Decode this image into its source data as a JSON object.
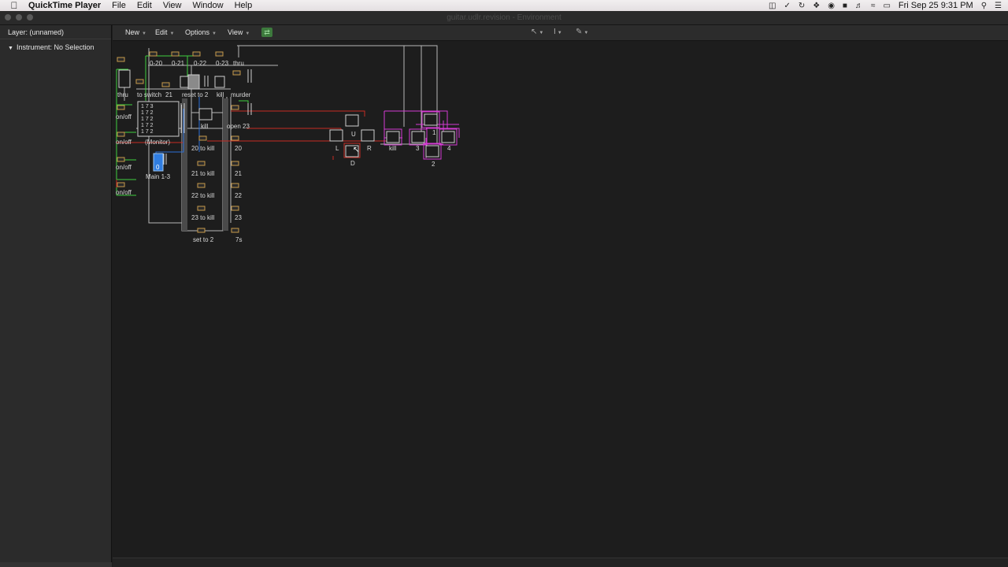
{
  "menubar": {
    "app_name": "QuickTime Player",
    "menus": [
      "File",
      "Edit",
      "View",
      "Window",
      "Help"
    ],
    "clock": "Fri Sep 25  9:31 PM"
  },
  "window": {
    "title": "guitar.udlr.revision - Environment"
  },
  "inspector": {
    "layer": "Layer: (unnamed)",
    "instrument": "Instrument:  No Selection"
  },
  "toolbar": {
    "new": "New",
    "edit": "Edit",
    "options": "Options",
    "view": "View"
  },
  "canvas": {
    "labels": {
      "l020": "0-20",
      "l021": "0-21",
      "l022": "0-22",
      "l023": "0-23",
      "thru": "thru",
      "thruto": "thru",
      "toswitch": "to switch",
      "n21": "21",
      "reset": "reset to 2",
      "kill_top": "kill",
      "murder": "murder",
      "onoff1": "on/off",
      "onoff2": "on/off",
      "onoff3": "on/off",
      "onoff4": "on/off",
      "kill_mid": "kill",
      "open23": "open 23",
      "monitor": "(Monitor)",
      "main13": "Main 1-3",
      "to20": "20 to kill",
      "n20": "20",
      "to21": "21 to kill",
      "n21b": "21",
      "to22": "22 to kill",
      "n22": "22",
      "to23": "23 to kill",
      "n23": "23",
      "setto2": "set to 2",
      "n7s": "7s",
      "L": "L",
      "U": "U",
      "R": "R",
      "D": "D",
      "kill_right": "kill",
      "n3": "3",
      "n1": "1",
      "n4": "4",
      "n2": "2"
    },
    "monitor_rows": [
      "1   7   3",
      "1   7   2",
      "1   7   2",
      "1   7   2",
      "1   7   2"
    ],
    "fader_value": "0",
    "colors": {
      "background": "#1d1d1d",
      "green_cable": "#3ecf3e",
      "red_cable": "#c62b22",
      "magenta_cable": "#d43bd2",
      "blue_cable": "#2c6fd6",
      "grey_cable": "#b8b8b8"
    }
  }
}
